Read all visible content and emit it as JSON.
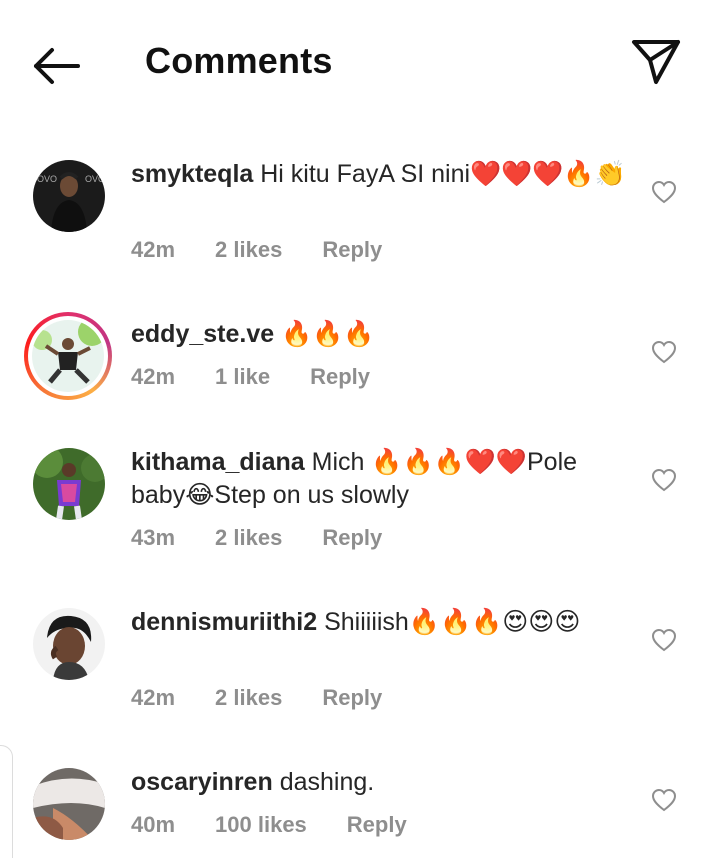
{
  "header": {
    "title": "Comments",
    "back_icon": "arrow-left-icon",
    "share_icon": "send-icon"
  },
  "colors": {
    "text": "#262626",
    "meta": "#8e8e8e",
    "story_ring": [
      "#fcaf45",
      "#e1306c",
      "#c13584"
    ]
  },
  "comments": [
    {
      "username": "smykteqla",
      "text": " Hi kitu FayA SI nini❤️❤️❤️🔥👏",
      "time": "42m",
      "likes": "2 likes",
      "reply": "Reply",
      "avatar_icon": "user-avatar-icon"
    },
    {
      "username": "eddy_ste.ve",
      "text": " 🔥🔥🔥",
      "time": "42m",
      "likes": "1 like",
      "reply": "Reply",
      "avatar_icon": "user-avatar-icon"
    },
    {
      "username": "kithama_diana",
      "text": " Mich 🔥🔥🔥❤️❤️Pole baby😂Step on us slowly",
      "time": "43m",
      "likes": "2 likes",
      "reply": "Reply",
      "avatar_icon": "user-avatar-icon"
    },
    {
      "username": "dennismuriithi2",
      "text": " Shiiiiish🔥🔥🔥😍😍😍",
      "time": "42m",
      "likes": "2 likes",
      "reply": "Reply",
      "avatar_icon": "user-avatar-icon"
    },
    {
      "username": "oscaryinren",
      "text": " dashing.",
      "time": "40m",
      "likes": "100 likes",
      "reply": "Reply",
      "avatar_icon": "user-avatar-icon"
    }
  ]
}
